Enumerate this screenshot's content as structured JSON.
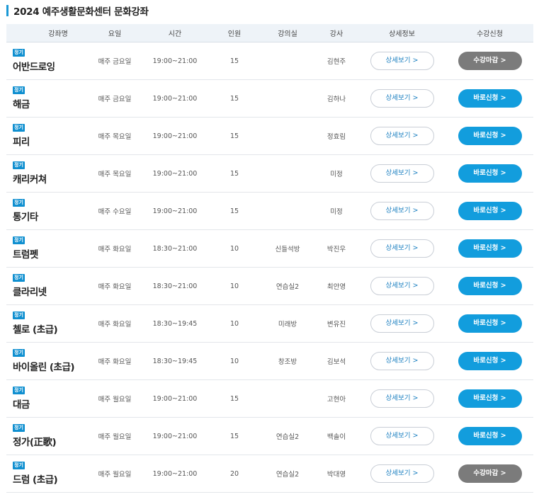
{
  "page": {
    "title": "2024 예주생활문화센터 문화강좌"
  },
  "colors": {
    "accent": "#1a98d5",
    "apply_open": "#129ddd",
    "apply_closed": "#7b7b7b",
    "badge": "#0f8fd0"
  },
  "table": {
    "headers": [
      "강좌명",
      "요일",
      "시간",
      "인원",
      "강의실",
      "강사",
      "상세정보",
      "수강신청"
    ],
    "rows": [
      {
        "badge": "정기",
        "name": "어반드로잉",
        "day": "매주 금요일",
        "time": "19:00~21:00",
        "capacity": "15",
        "room": "",
        "instructor": "김현주",
        "detail": "상세보기 >",
        "apply": "수강마감 >",
        "status": "closed"
      },
      {
        "badge": "정기",
        "name": "해금",
        "day": "매주 금요일",
        "time": "19:00~21:00",
        "capacity": "15",
        "room": "",
        "instructor": "김하나",
        "detail": "상세보기 >",
        "apply": "바로신청 >",
        "status": "open"
      },
      {
        "badge": "정기",
        "name": "피리",
        "day": "매주 목요일",
        "time": "19:00~21:00",
        "capacity": "15",
        "room": "",
        "instructor": "정효림",
        "detail": "상세보기 >",
        "apply": "바로신청 >",
        "status": "open"
      },
      {
        "badge": "정기",
        "name": "캐리커쳐",
        "day": "매주 목요일",
        "time": "19:00~21:00",
        "capacity": "15",
        "room": "",
        "instructor": "미정",
        "detail": "상세보기 >",
        "apply": "바로신청 >",
        "status": "open"
      },
      {
        "badge": "정기",
        "name": "통기타",
        "day": "매주 수요일",
        "time": "19:00~21:00",
        "capacity": "15",
        "room": "",
        "instructor": "미정",
        "detail": "상세보기 >",
        "apply": "바로신청 >",
        "status": "open"
      },
      {
        "badge": "정기",
        "name": "트럼펫",
        "day": "매주 화요일",
        "time": "18:30~21:00",
        "capacity": "10",
        "room": "신들석방",
        "instructor": "박진우",
        "detail": "상세보기 >",
        "apply": "바로신청 >",
        "status": "open"
      },
      {
        "badge": "정기",
        "name": "클라리넷",
        "day": "매주 화요일",
        "time": "18:30~21:00",
        "capacity": "10",
        "room": "연습실2",
        "instructor": "최안영",
        "detail": "상세보기 >",
        "apply": "바로신청 >",
        "status": "open"
      },
      {
        "badge": "정기",
        "name": "첼로 (초급)",
        "day": "매주 화요일",
        "time": "18:30~19:45",
        "capacity": "10",
        "room": "미래방",
        "instructor": "변유진",
        "detail": "상세보기 >",
        "apply": "바로신청 >",
        "status": "open"
      },
      {
        "badge": "정기",
        "name": "바이올린 (초급)",
        "day": "매주 화요일",
        "time": "18:30~19:45",
        "capacity": "10",
        "room": "창조방",
        "instructor": "김보석",
        "detail": "상세보기 >",
        "apply": "바로신청 >",
        "status": "open"
      },
      {
        "badge": "정기",
        "name": "대금",
        "day": "매주 월요일",
        "time": "19:00~21:00",
        "capacity": "15",
        "room": "",
        "instructor": "고현아",
        "detail": "상세보기 >",
        "apply": "바로신청 >",
        "status": "open"
      },
      {
        "badge": "정기",
        "name": "정가(正歌)",
        "day": "매주 월요일",
        "time": "19:00~21:00",
        "capacity": "15",
        "room": "연습실2",
        "instructor": "백솔이",
        "detail": "상세보기 >",
        "apply": "바로신청 >",
        "status": "open"
      },
      {
        "badge": "정기",
        "name": "드럼 (초급)",
        "day": "매주 월요일",
        "time": "19:00~21:00",
        "capacity": "20",
        "room": "연습실2",
        "instructor": "박대영",
        "detail": "상세보기 >",
        "apply": "수강마감 >",
        "status": "closed"
      }
    ]
  }
}
